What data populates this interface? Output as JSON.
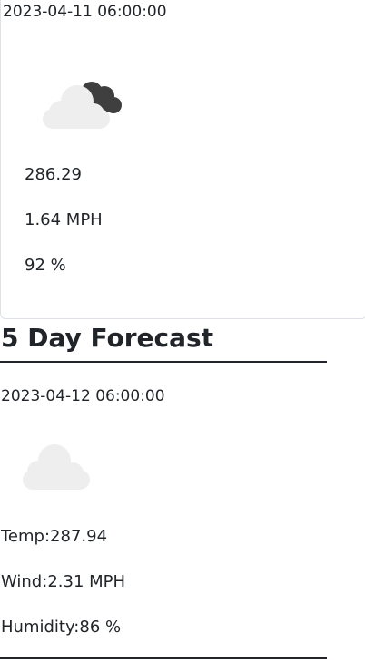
{
  "current": {
    "date": "2023-04-11 06:00:00",
    "icon": "broken-clouds-icon",
    "temp": "286.29",
    "wind": "1.64 MPH",
    "humidity": "92 %"
  },
  "forecast": {
    "heading": "5 Day Forecast",
    "days": [
      {
        "date": "2023-04-12 06:00:00",
        "icon": "cloud-icon",
        "temp_label": "Temp:",
        "temp": "287.94",
        "wind_label": "Wind:",
        "wind": "2.31 MPH",
        "humidity_label": "Humidity:",
        "humidity": "86 %"
      }
    ]
  },
  "colors": {
    "cloud_light": "#eeeeee",
    "cloud_dark": "#3f3f3f",
    "text": "#212529",
    "card_border": "#dee2e6"
  }
}
